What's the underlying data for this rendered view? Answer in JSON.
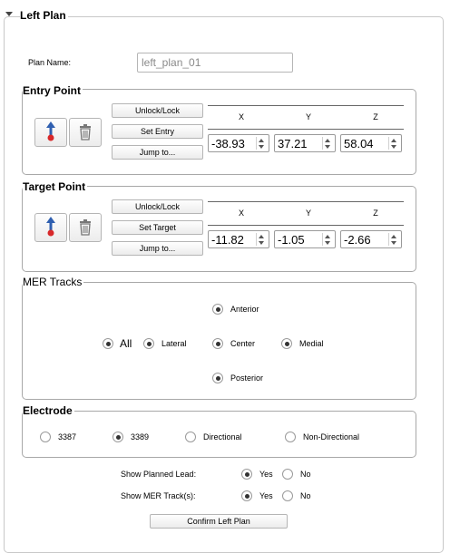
{
  "panel_title": "Left Plan",
  "plan_name": {
    "label": "Plan Name:",
    "value": "left_plan_01"
  },
  "entry": {
    "title": "Entry Point",
    "unlock_label": "Unlock/Lock",
    "set_label": "Set Entry",
    "jump_label": "Jump to...",
    "headers": [
      "X",
      "Y",
      "Z"
    ],
    "values": [
      "-38.93",
      "37.21",
      "58.04"
    ]
  },
  "target": {
    "title": "Target Point",
    "unlock_label": "Unlock/Lock",
    "set_label": "Set Target",
    "jump_label": "Jump to...",
    "headers": [
      "X",
      "Y",
      "Z"
    ],
    "values": [
      "-11.82",
      "-1.05",
      "-2.66"
    ]
  },
  "mer": {
    "title": "MER Tracks",
    "all": "All",
    "lateral": "Lateral",
    "center": "Center",
    "medial": "Medial",
    "anterior": "Anterior",
    "posterior": "Posterior"
  },
  "electrode": {
    "title": "Electrode",
    "options": [
      "3387",
      "3389",
      "Directional",
      "Non-Directional"
    ],
    "selected": "3389"
  },
  "show_planned_lead": {
    "label": "Show Planned Lead:",
    "yes": "Yes",
    "no": "No",
    "selected": "Yes"
  },
  "show_mer_tracks": {
    "label": "Show MER Track(s):",
    "yes": "Yes",
    "no": "No",
    "selected": "Yes"
  },
  "confirm_label": "Confirm Left Plan",
  "icons": {
    "point": "arrow-point-icon",
    "delete": "trash-icon"
  },
  "colors": {
    "arrow": "#2f5fb0",
    "dot": "#d8282a"
  }
}
